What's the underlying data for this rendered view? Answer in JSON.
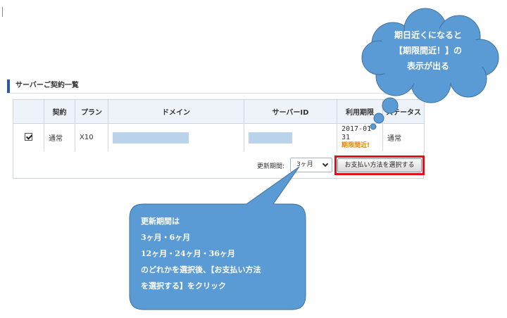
{
  "section": {
    "title": "サーバーご契約一覧"
  },
  "table": {
    "headers": {
      "contract": "契約",
      "plan": "プラン",
      "domain": "ドメイン",
      "server_id": "サーバーID",
      "expiry": "利用期限",
      "status": "ステータス"
    },
    "rows": [
      {
        "checked": true,
        "contract": "通常",
        "plan": "X10",
        "expiry": "2017-01-31",
        "expiry_warning": "期限間近!",
        "status": "通常"
      }
    ]
  },
  "footer": {
    "period_label": "更新期間:",
    "period_value": "3ヶ月",
    "pay_button": "お支払い方法を選択する"
  },
  "callout_cloud": {
    "lines": [
      "期日近くになると",
      "【期限間近！】の",
      "表示が出る"
    ]
  },
  "callout_bubble": {
    "lines": [
      "更新期間は",
      "3ヶ月・6ヶ月",
      "12ヶ月・24ヶ月・36ヶ月",
      "のどれかを選択後、【お支払い方法",
      "を選択する】をクリック"
    ]
  },
  "colors": {
    "accent_blue": "#2b5a9e",
    "callout_blue": "#5b9bd5",
    "highlight_red": "#e0131a",
    "warning_orange": "#e38b00"
  }
}
